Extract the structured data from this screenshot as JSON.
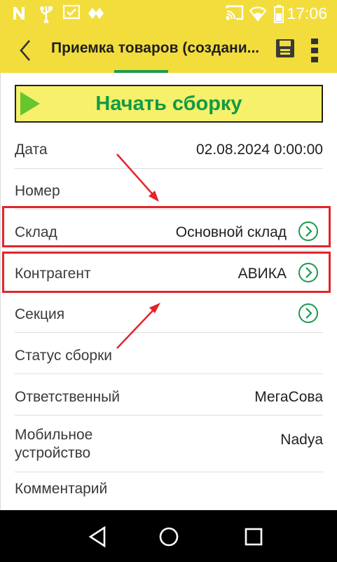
{
  "status_bar": {
    "time": "17:06",
    "icons": [
      "n-icon",
      "usb-icon",
      "check-box-icon",
      "diamond-icon",
      "cast-icon",
      "wifi-icon",
      "battery-icon"
    ]
  },
  "header": {
    "title": "Приемка товаров (создани...",
    "icons": [
      "back-icon",
      "save-icon",
      "more-vert-icon"
    ]
  },
  "start_button": {
    "label": "Начать сборку",
    "icon": "play-icon"
  },
  "fields": [
    {
      "label": "Дата",
      "value": "02.08.2024  0:00:00",
      "chevron": false
    },
    {
      "label": "Номер",
      "value": "",
      "chevron": false
    },
    {
      "label": "Склад",
      "value": "Основной склад",
      "chevron": true
    },
    {
      "label": "Контрагент",
      "value": "АВИКА",
      "chevron": true
    },
    {
      "label": "Секция",
      "value": "",
      "chevron": true
    },
    {
      "label": "Статус сборки",
      "value": "",
      "chevron": false
    },
    {
      "label": "Ответственный",
      "value": "МегаСова",
      "chevron": false
    },
    {
      "label": "Мобильное устройство",
      "value": "Nadya",
      "chevron": false
    },
    {
      "label": "Комментарий",
      "value": "",
      "chevron": false
    }
  ],
  "colors": {
    "header_bg": "#f2dd3c",
    "accent_green": "#129a45",
    "highlight_red": "#e2252b",
    "button_bg": "#f6f06a"
  },
  "nav_bar": {
    "icons": [
      "back-triangle-icon",
      "home-circle-icon",
      "recents-square-icon"
    ]
  }
}
